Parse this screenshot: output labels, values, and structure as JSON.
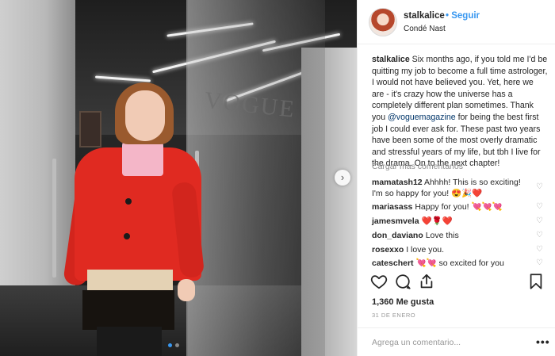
{
  "post": {
    "username": "stalkalice",
    "follow_label": "Seguir",
    "location": "Condé Nast",
    "photo_sign": "VOGUE",
    "caption_user": "stalkalice",
    "caption_part1": "Six months ago, if you told me I'd be quitting my job to become a full time astrologer, I would not have believed you. Yet, here we are - it's crazy how the universe has a completely different plan sometimes. Thank you",
    "caption_mention": "@voguemagazine",
    "caption_part2": "for being the best first job I could ever ask for. These past two years have been some of the most overly dramatic and stressful years of my life, but tbh I live for the drama. On to the next chapter!",
    "load_more": "Cargar más comentarios",
    "likes": "1,360 Me gusta",
    "date": "31 DE ENERO",
    "add_comment_placeholder": "Agrega un comentario...",
    "more_label": "•••",
    "next_arrow": "›"
  },
  "comments": [
    {
      "user": "mamatash12",
      "text": "Ahhhh! This is so exciting! I'm so happy for you! 😍🎉❤️"
    },
    {
      "user": "mariasass",
      "text": "Happy for you! 💘💘💘"
    },
    {
      "user": "jamesmvela",
      "text": "❤️🌹❤️"
    },
    {
      "user": "don_daviano",
      "text": "Love this"
    },
    {
      "user": "rosexxo",
      "text": "I love you."
    },
    {
      "user": "cateschert",
      "text": "💘💘 so excited for you"
    }
  ],
  "icons": {
    "like": "heart-icon",
    "comment": "comment-icon",
    "share": "share-icon",
    "save": "bookmark-icon",
    "comment_like": "heart-icon"
  },
  "colors": {
    "link": "#3897f0",
    "mention": "#003569",
    "muted": "#8e8e8e"
  }
}
